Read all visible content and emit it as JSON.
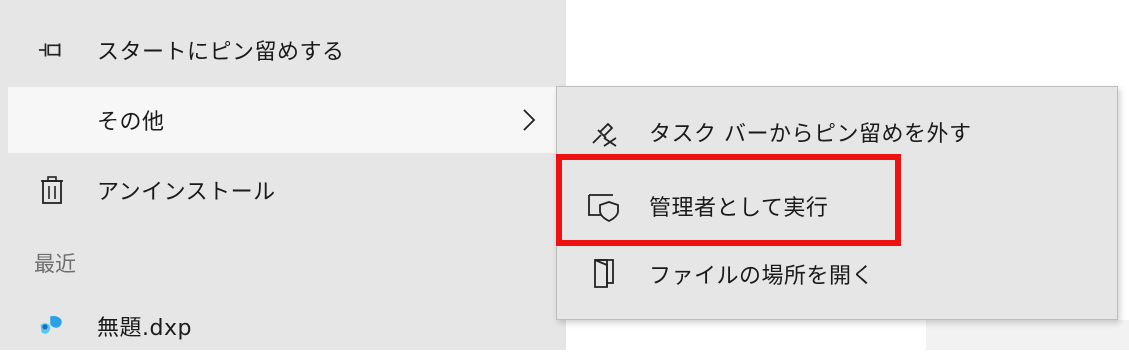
{
  "main_menu": {
    "items": [
      {
        "label": "スタートにピン留めする",
        "icon": "pin-icon"
      },
      {
        "label": "その他",
        "icon": "",
        "has_submenu": true
      },
      {
        "label": "アンインストール",
        "icon": "trash-icon"
      }
    ],
    "recent_header": "最近",
    "recent_items": [
      {
        "label": "無題.dxp",
        "icon": "app-file-icon"
      }
    ]
  },
  "submenu": {
    "items": [
      {
        "label": "タスク バーからピン留めを外す",
        "icon": "unpin-icon"
      },
      {
        "label": "管理者として実行",
        "icon": "admin-shield-icon",
        "highlighted": true
      },
      {
        "label": "ファイルの場所を開く",
        "icon": "folder-open-icon"
      }
    ]
  },
  "colors": {
    "menu_background": "#e6e6e6",
    "hover_background": "#f7f7f7",
    "highlight_border": "#ee1111",
    "header_text": "#6e6e6e"
  }
}
